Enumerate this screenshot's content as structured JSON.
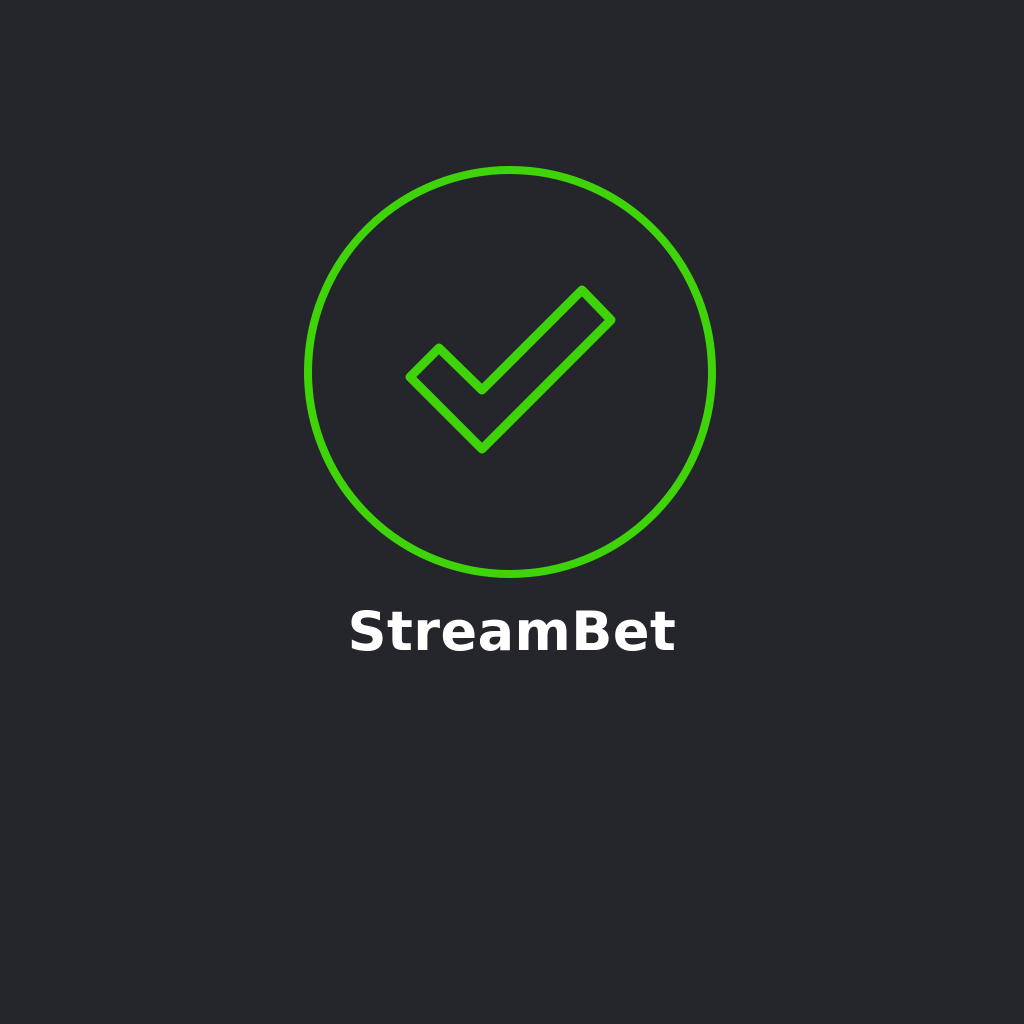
{
  "brand": {
    "name": "StreamBet",
    "icon": "check-circle-icon",
    "accent_color": "#3fd40a",
    "text_color": "#ffffff",
    "background_color": "#25262b"
  }
}
